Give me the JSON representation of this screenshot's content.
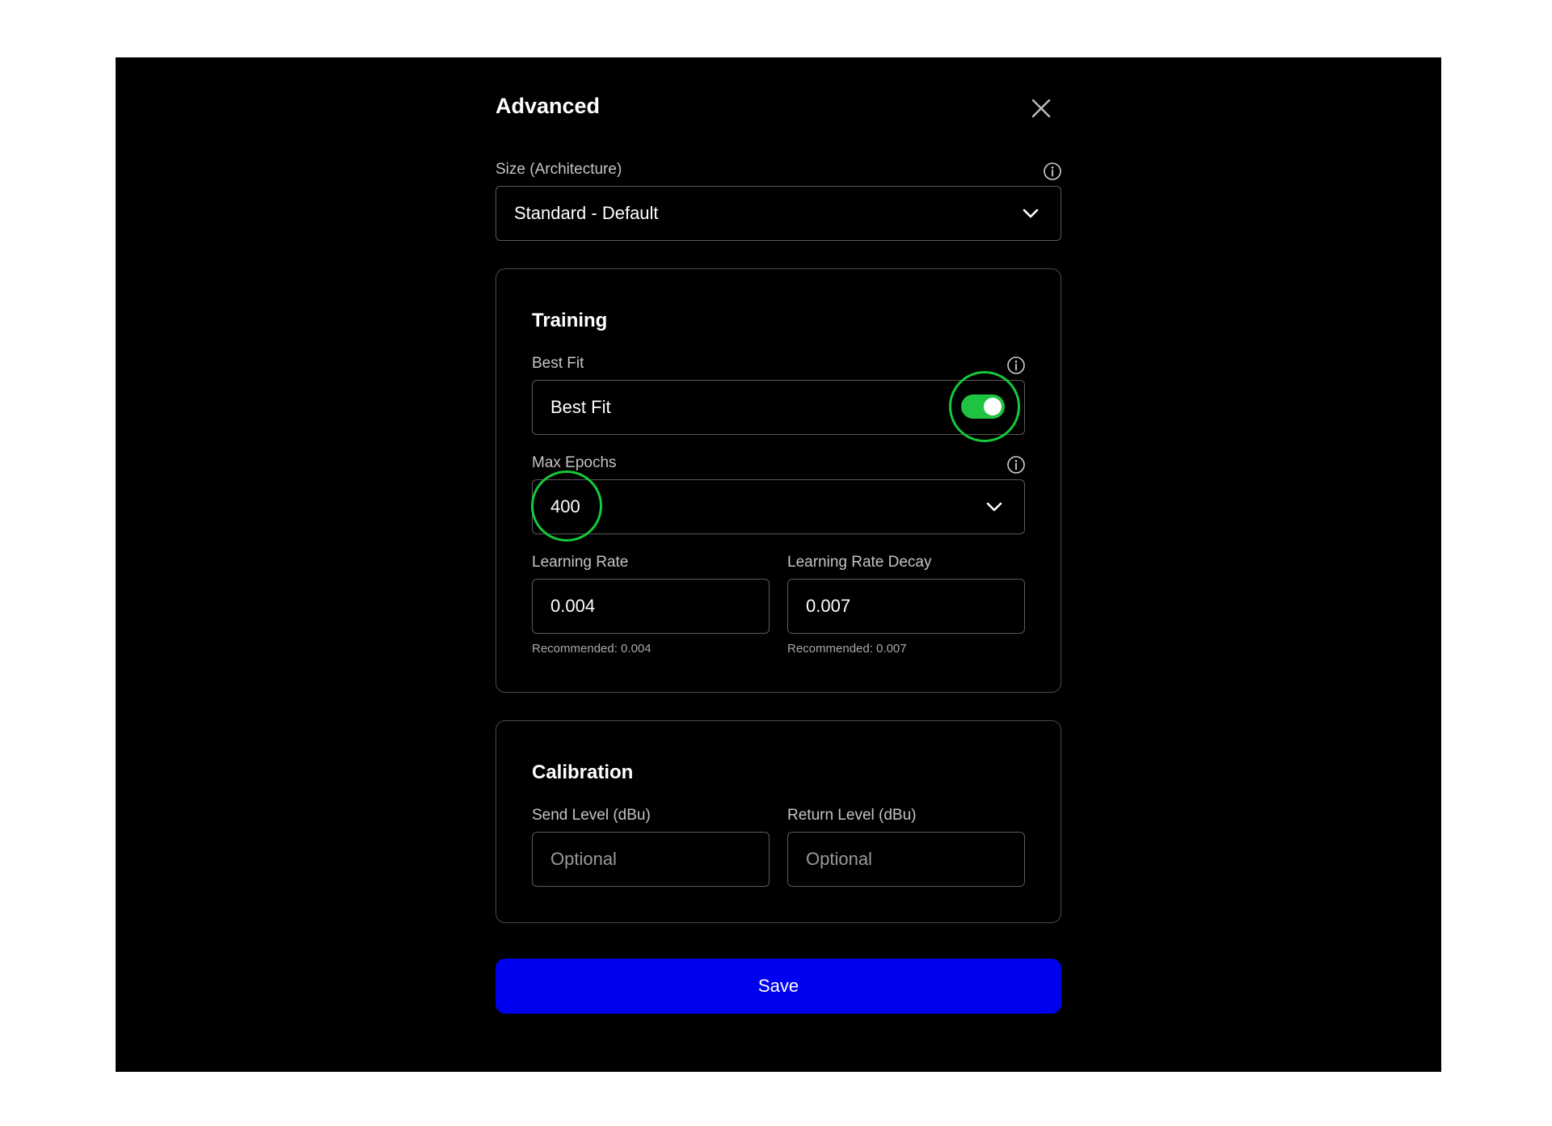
{
  "dialog": {
    "title": "Advanced"
  },
  "size": {
    "label": "Size (Architecture)",
    "value": "Standard - Default"
  },
  "training": {
    "title": "Training",
    "best_fit": {
      "label": "Best Fit",
      "value": "Best Fit",
      "enabled": true
    },
    "max_epochs": {
      "label": "Max Epochs",
      "value": "400"
    },
    "learning_rate": {
      "label": "Learning Rate",
      "value": "0.004",
      "hint": "Recommended: 0.004"
    },
    "learning_rate_decay": {
      "label": "Learning Rate Decay",
      "value": "0.007",
      "hint": "Recommended: 0.007"
    }
  },
  "calibration": {
    "title": "Calibration",
    "send_level": {
      "label": "Send Level (dBu)",
      "placeholder": "Optional"
    },
    "return_level": {
      "label": "Return Level (dBu)",
      "placeholder": "Optional"
    }
  },
  "save_label": "Save",
  "colors": {
    "background": "#000000",
    "toggle_on": "#1ec43f",
    "highlight": "#15c93a",
    "save_button": "#0000f0"
  },
  "icons": {
    "close": "close-icon",
    "info": "info-icon",
    "chevron": "chevron-down-icon"
  }
}
